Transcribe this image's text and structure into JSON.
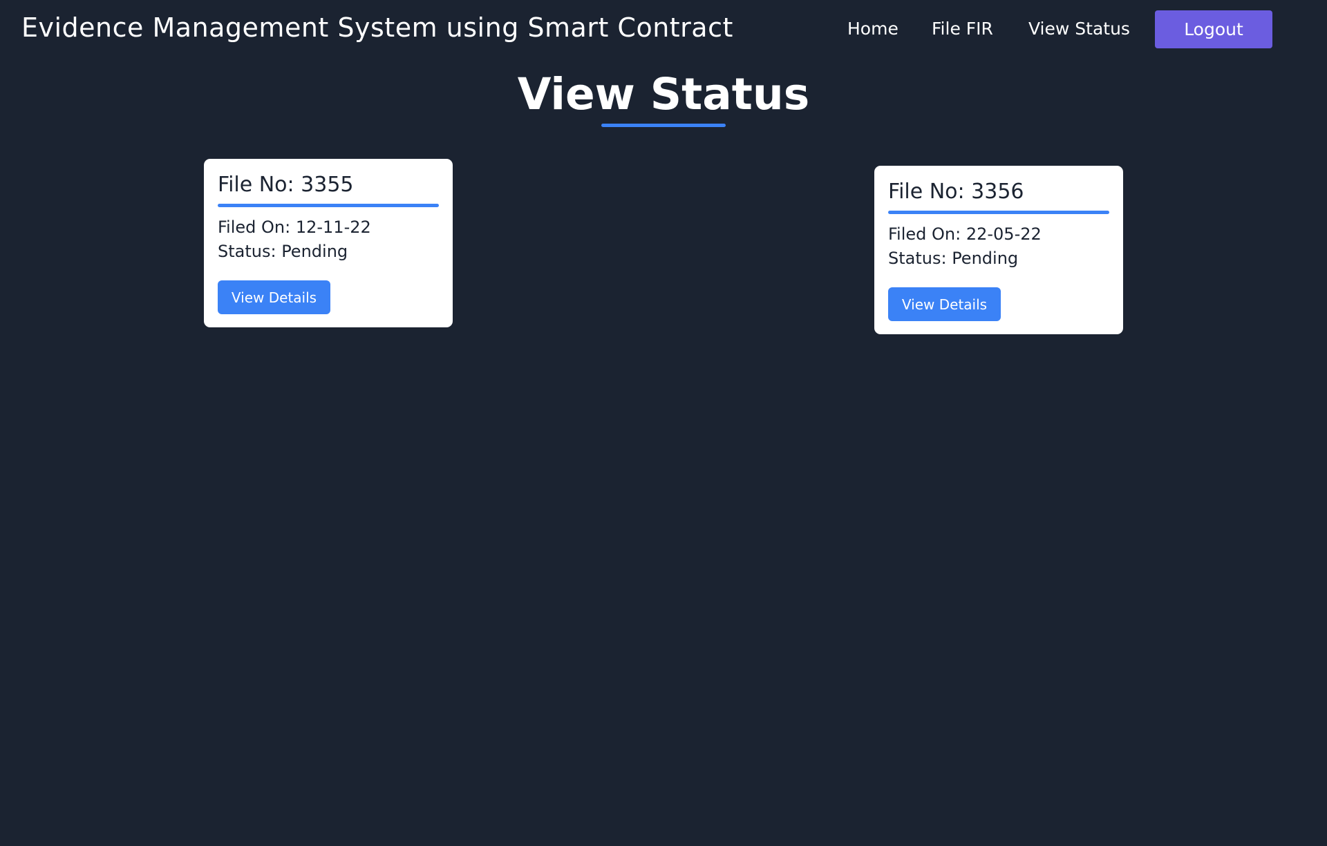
{
  "navbar": {
    "brand": "Evidence Management System using Smart Contract",
    "links": [
      {
        "label": "Home"
      },
      {
        "label": "File FIR"
      },
      {
        "label": "View Status"
      }
    ],
    "logout_label": "Logout"
  },
  "page": {
    "title": "View Status"
  },
  "cards": [
    {
      "title": "File No: 3355",
      "filed_on": "Filed On: 12-11-22",
      "status": "Status: Pending",
      "button_label": "View Details"
    },
    {
      "title": "File No: 3356",
      "filed_on": "Filed On: 22-05-22",
      "status": "Status: Pending",
      "button_label": "View Details"
    }
  ],
  "colors": {
    "background": "#1b2331",
    "accent": "#3b82f6",
    "logout": "#6b5de0",
    "card": "#ffffff"
  }
}
